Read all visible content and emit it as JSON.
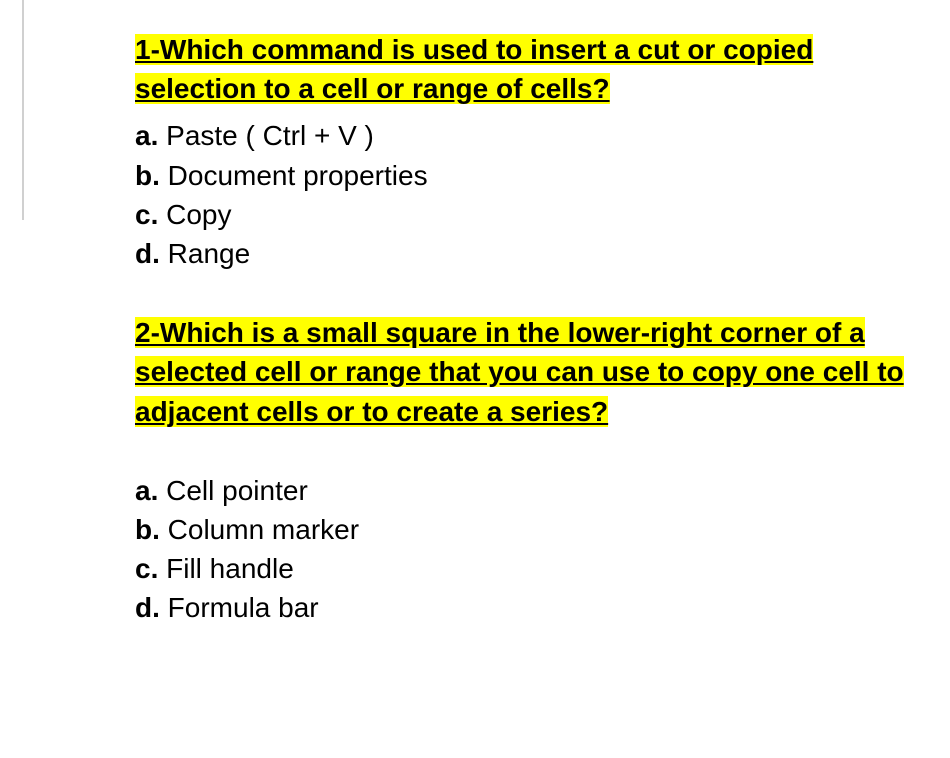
{
  "questions": [
    {
      "title": "1-Which command is used to insert a cut or copied selection to a cell or range of cells? ",
      "options": [
        {
          "label": "a.",
          "text": " Paste  ( Ctrl + V )"
        },
        {
          "label": "b.",
          "text": " Document properties"
        },
        {
          "label": "c.",
          "text": " Copy"
        },
        {
          "label": "d.",
          "text": " Range"
        }
      ]
    },
    {
      "title": "2-Which is a small square in the lower-right corner of a selected cell or range that you can use to copy one cell to adjacent cells or to create a series? ",
      "options": [
        {
          "label": "a.",
          "text": " Cell pointer"
        },
        {
          "label": "b.",
          "text": " Column marker"
        },
        {
          "label": "c.",
          "text": " Fill handle"
        },
        {
          "label": "d.",
          "text": " Formula bar"
        }
      ]
    }
  ]
}
